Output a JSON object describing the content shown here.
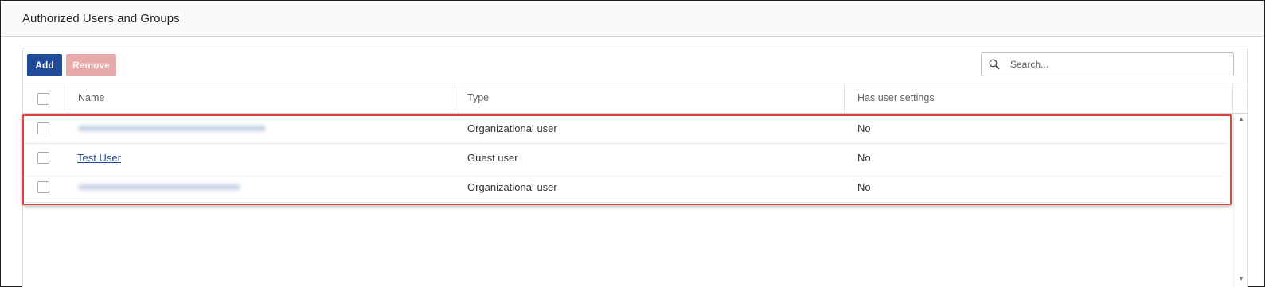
{
  "panel": {
    "title": "Authorized Users and Groups"
  },
  "toolbar": {
    "add_label": "Add",
    "remove_label": "Remove",
    "search_placeholder": "Search...",
    "search_value": ""
  },
  "table": {
    "columns": [
      "Name",
      "Type",
      "Has user settings"
    ],
    "rows": [
      {
        "name": "",
        "name_blurred": true,
        "type": "Organizational user",
        "has_user_settings": "No"
      },
      {
        "name": "Test User",
        "name_blurred": false,
        "type": "Guest user",
        "has_user_settings": "No"
      },
      {
        "name": "",
        "name_blurred": true,
        "type": "Organizational user",
        "has_user_settings": "No"
      }
    ]
  },
  "colors": {
    "accent": "#1f4a99",
    "remove_disabled": "#e8a9aa",
    "highlight": "#e0403f"
  }
}
